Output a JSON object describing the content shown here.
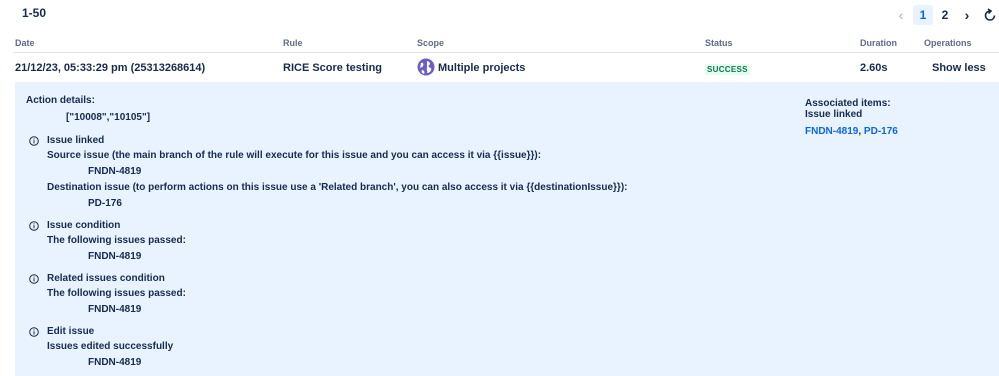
{
  "header": {
    "range": "1-50",
    "pagination": {
      "prev": "‹",
      "pages": [
        "1",
        "2"
      ],
      "current": "1",
      "next": "›"
    }
  },
  "table": {
    "columns": {
      "date": "Date",
      "rule": "Rule",
      "scope": "Scope",
      "status": "Status",
      "duration": "Duration",
      "operations": "Operations"
    },
    "row": {
      "date": "21/12/23, 05:33:29 pm (25313268614)",
      "rule": "RICE Score testing",
      "scope": "Multiple projects",
      "status": "SUCCESS",
      "duration": "2.60s",
      "operation": "Show less"
    }
  },
  "details": {
    "action_title": "Action details:",
    "action_value": "[\"10008\",\"10105\"]",
    "sections": [
      {
        "title": "Issue linked",
        "lines": [
          {
            "text": "Source issue (the main branch of the rule will execute for this issue and you can access it via {{issue}}):"
          },
          {
            "text": "FNDN-4819"
          },
          {
            "text": "Destination issue (to perform actions on this issue use a 'Related branch', you can also access it via {{destinationIssue}}):"
          },
          {
            "text": "PD-176"
          }
        ]
      },
      {
        "title": "Issue condition",
        "lines": [
          {
            "text": "The following issues passed:"
          },
          {
            "text": "FNDN-4819"
          }
        ]
      },
      {
        "title": "Related issues condition",
        "lines": [
          {
            "text": "The following issues passed:"
          },
          {
            "text": "FNDN-4819"
          }
        ]
      },
      {
        "title": "Edit issue",
        "lines": [
          {
            "text": "Issues edited successfully"
          },
          {
            "text": "FNDN-4819"
          }
        ]
      }
    ],
    "associated": {
      "title": "Associated items:",
      "subtitle": "Issue linked",
      "links": [
        "FNDN-4819",
        "PD-176"
      ],
      "separator": ","
    }
  },
  "colors": {
    "accent": "#0c66e4",
    "panel": "#e9f2ff",
    "success_text": "#216e4e",
    "success_bg": "#dcfff1"
  },
  "icons": {
    "prev": "chevron-left-icon",
    "next": "chevron-right-icon",
    "refresh": "refresh-icon",
    "info": "info-icon",
    "scope": "globe-icon"
  }
}
